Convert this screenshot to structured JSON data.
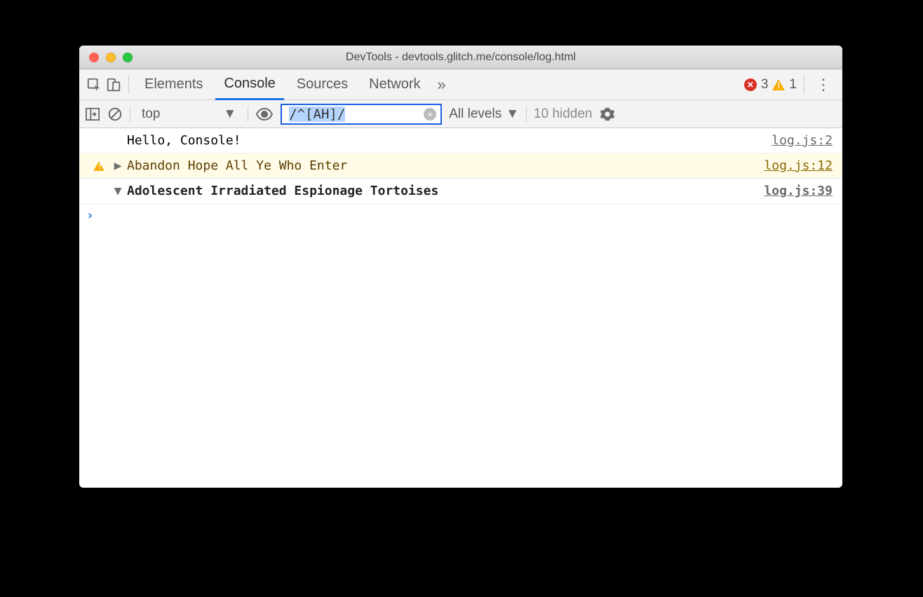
{
  "window": {
    "title": "DevTools - devtools.glitch.me/console/log.html"
  },
  "tabs": {
    "elements": "Elements",
    "console": "Console",
    "sources": "Sources",
    "network": "Network"
  },
  "status": {
    "error_count": "3",
    "warning_count": "1"
  },
  "toolbar": {
    "context": "top",
    "filter_value": "/^[AH]/",
    "levels_label": "All levels",
    "hidden_label": "10 hidden"
  },
  "logs": [
    {
      "message": "Hello, Console!",
      "source": "log.js:2"
    },
    {
      "message": "Abandon Hope All Ye Who Enter",
      "source": "log.js:12"
    },
    {
      "message": "Adolescent Irradiated Espionage Tortoises",
      "source": "log.js:39"
    }
  ]
}
